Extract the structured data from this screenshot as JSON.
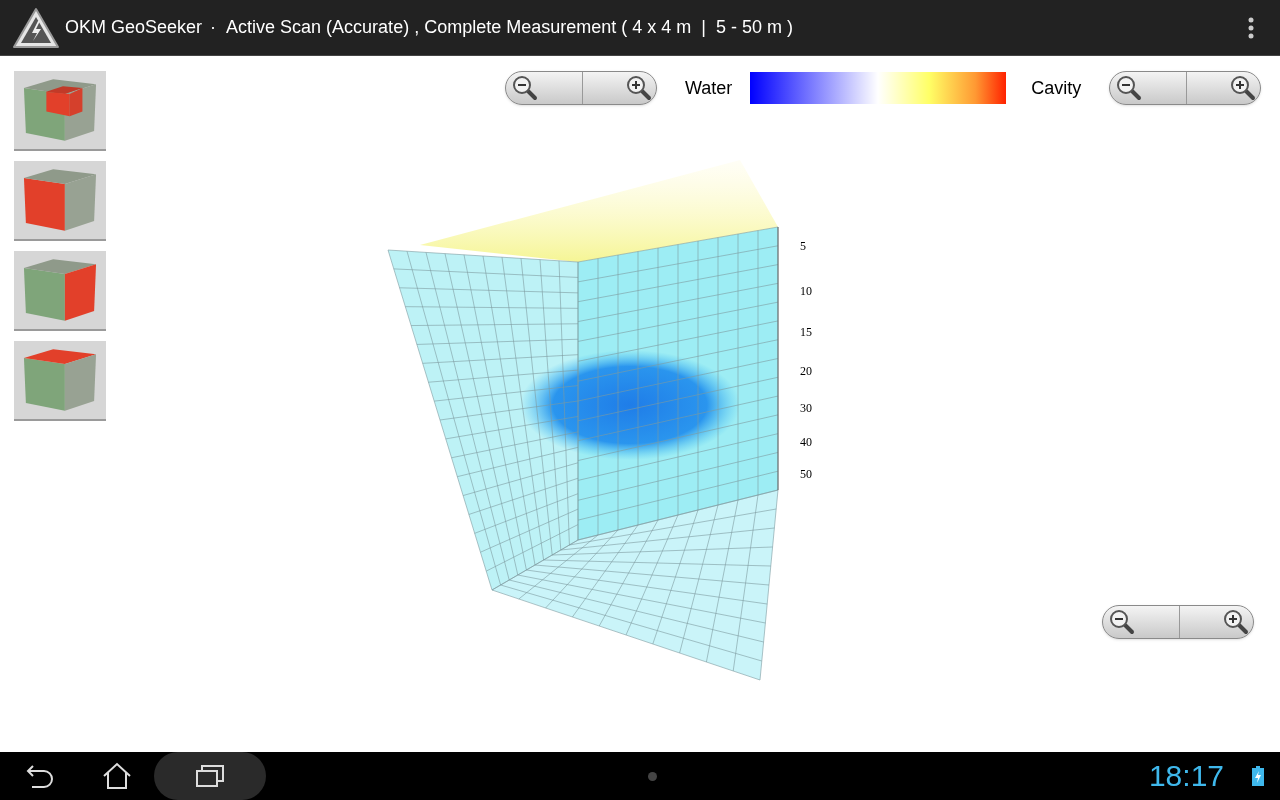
{
  "app_bar": {
    "app_name": "OKM GeoSeeker",
    "separator": "·",
    "subtitle": "Active Scan (Accurate) , Complete Measurement ( 4 x 4 m  |  5 - 50 m )"
  },
  "view_buttons": [
    {
      "kind": "inner"
    },
    {
      "kind": "front"
    },
    {
      "kind": "right"
    },
    {
      "kind": "top"
    }
  ],
  "legend": {
    "low_label": "Water",
    "high_label": "Cavity"
  },
  "depth_scale": [
    "5",
    "10",
    "15",
    "20",
    "30",
    "40",
    "50"
  ],
  "status_bar": {
    "time": "18:17"
  }
}
